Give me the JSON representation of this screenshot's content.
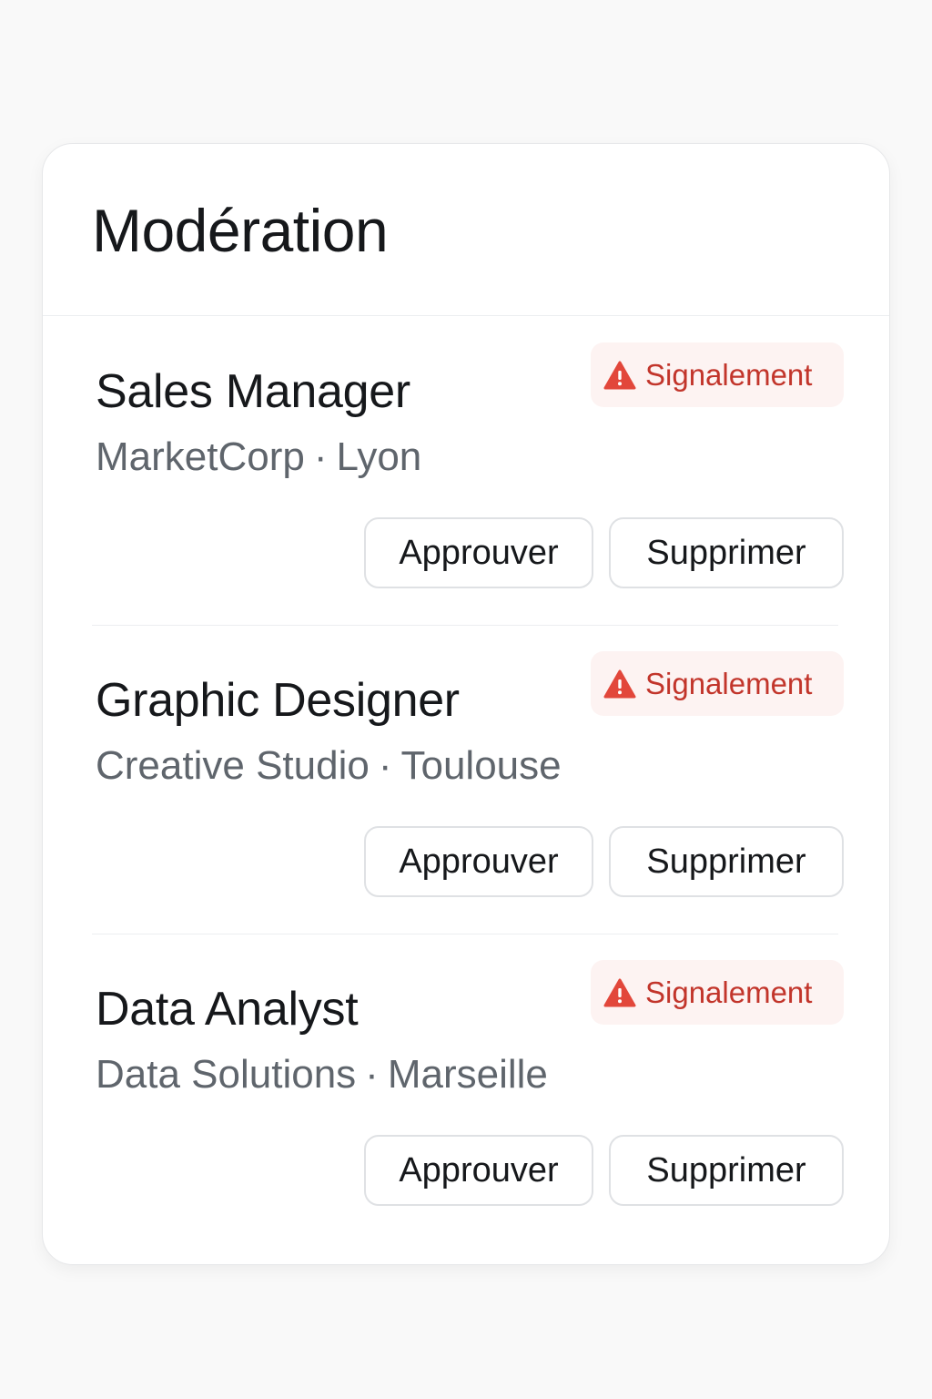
{
  "page": {
    "title": "Modération"
  },
  "listings": [
    {
      "title": "Sales Manager",
      "company": "MarketCorp",
      "separator": "·",
      "location": "Lyon",
      "badge": {
        "label": "Signalement",
        "icon": "warning-triangle-icon"
      },
      "approve_label": "Approuver",
      "delete_label": "Supprimer"
    },
    {
      "title": "Graphic Designer",
      "company": "Creative Studio",
      "separator": "·",
      "location": "Toulouse",
      "badge": {
        "label": "Signalement",
        "icon": "warning-triangle-icon"
      },
      "approve_label": "Approuver",
      "delete_label": "Supprimer"
    },
    {
      "title": "Data Analyst",
      "company": "Data Solutions",
      "separator": "·",
      "location": "Marseille",
      "badge": {
        "label": "Signalement",
        "icon": "warning-triangle-icon"
      },
      "approve_label": "Approuver",
      "delete_label": "Supprimer"
    }
  ],
  "colors": {
    "background": "#f9f9f9",
    "card": "#ffffff",
    "title_text": "#16181b",
    "meta_text": "#5f656c",
    "badge_bg": "#fdf3f2",
    "badge_text": "#c2352b",
    "warning_icon": "#e2473b",
    "button_border": "#dfe1e4"
  }
}
